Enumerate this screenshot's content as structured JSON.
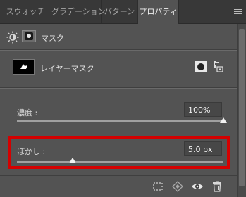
{
  "tabs": [
    {
      "label": "スウォッチ",
      "active": false
    },
    {
      "label": "グラデーション",
      "active": false
    },
    {
      "label": "パターン",
      "active": false
    },
    {
      "label": "プロパティ",
      "active": true
    }
  ],
  "toolbar": {
    "mask_label": "マスク"
  },
  "layer": {
    "label": "レイヤーマスク"
  },
  "density": {
    "label": "濃度 :",
    "value": "100%",
    "level": 1.0
  },
  "feather": {
    "label": "ぼかし :",
    "value": "5.0 px",
    "level": 0.27
  },
  "colors": {
    "highlight": "#d40000",
    "panel": "#535353",
    "tab_bar": "#383838"
  }
}
